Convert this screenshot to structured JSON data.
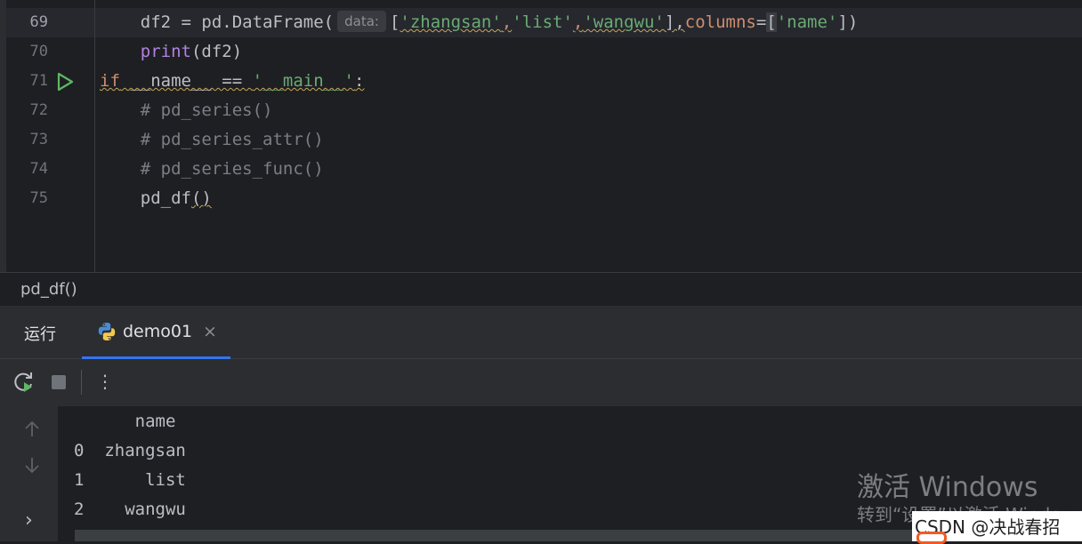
{
  "editor": {
    "lines": [
      {
        "no": "69"
      },
      {
        "no": "70"
      },
      {
        "no": "71"
      },
      {
        "no": "72"
      },
      {
        "no": "73"
      },
      {
        "no": "74"
      },
      {
        "no": "75"
      }
    ],
    "code": {
      "l69_a": "    df2 = pd.DataFrame(",
      "l69_hint": "data:",
      "l69_b1": "[",
      "l69_s1": "'zhangsan'",
      "l69_c1": ",",
      "l69_s2": "'list'",
      "l69_c2": ",",
      "l69_s3": "'wangwu'",
      "l69_b2": "],",
      "l69_param": "columns",
      "l69_eq": "=",
      "l69_b3": "[",
      "l69_s4": "'name'",
      "l69_b4": "])",
      "l70_a": "    ",
      "l70_fn": "print",
      "l70_b": "(df2)",
      "l71_kw": "if",
      "l71_a": " __name__ == ",
      "l71_s": "'__main__'",
      "l71_b": ":",
      "l72": "    # pd_series()",
      "l73": "    # pd_series_attr()",
      "l74": "    # pd_series_func()",
      "l75_a": "    pd_df",
      "l75_b": "()"
    }
  },
  "breadcrumb": {
    "text": "pd_df()"
  },
  "run_window": {
    "title": "运行",
    "tab_label": "demo01",
    "tab_close": "×",
    "toolbar_more": "⋮",
    "output": [
      "      name",
      "0  zhangsan",
      "1      list",
      "2    wangwu"
    ],
    "side_expand": "›"
  },
  "watermark": {
    "line1": "激活 Windows",
    "line2": "转到“设置”以激活 Windows",
    "csdn": "CSDN @决战春招"
  },
  "colors": {
    "keyword": "#cf8e6d",
    "string": "#6aab73",
    "function": "#b282e0",
    "comment": "#7a7e85",
    "accent": "#3574f0",
    "run_green": "#5fb865"
  }
}
